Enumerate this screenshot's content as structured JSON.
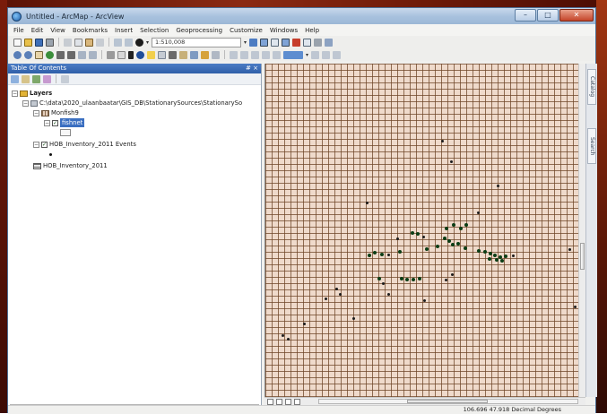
{
  "window": {
    "title": "Untitled - ArcMap - ArcView",
    "buttons": {
      "minimize": "–",
      "maximize": "□",
      "close": "✕"
    }
  },
  "menu": [
    "File",
    "Edit",
    "View",
    "Bookmarks",
    "Insert",
    "Selection",
    "Geoprocessing",
    "Customize",
    "Windows",
    "Help"
  ],
  "toolbar": {
    "scale": "1:510,008"
  },
  "toc": {
    "title": "Table Of Contents",
    "controls": "# ×",
    "layers_label": "Layers",
    "path_label": "C:\\data\\2020_ulaanbaatar\\GIS_DB\\StationarySources\\StationarySo",
    "group_label": "Monfish9",
    "fishnet_label": "fishnet",
    "events_label": "HOB_Inventory_2011 Events",
    "table_label": "HOB_Inventory_2011"
  },
  "side_dock": {
    "tab1": "Catalog",
    "tab2": "Search"
  },
  "status": {
    "coords": "106.696  47.918 Decimal Degrees"
  },
  "colors": {
    "grid_fill": "#efdacb",
    "grid_line": "#6e4426",
    "point": "#0b3d15",
    "selection": "#3b6fc1"
  }
}
